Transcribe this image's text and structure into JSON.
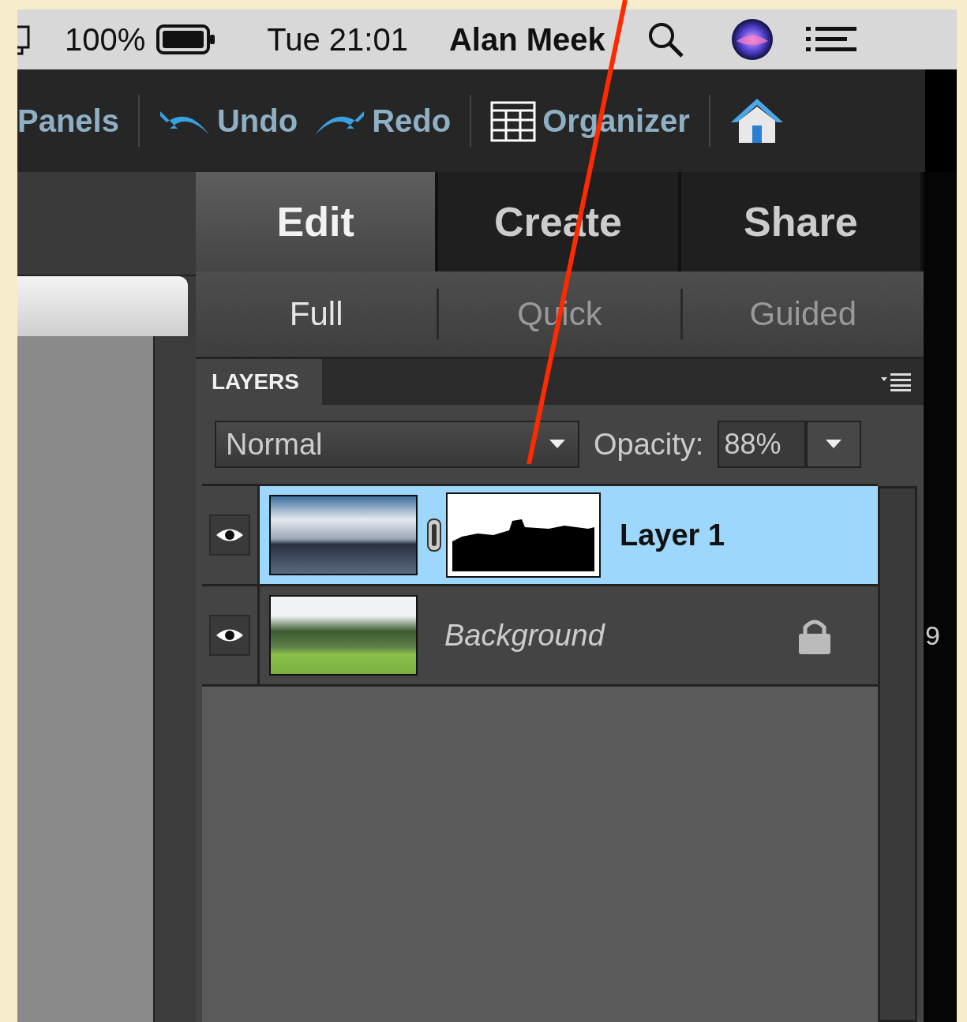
{
  "menubar": {
    "battery_percent": "100%",
    "clock": "Tue 21:01",
    "user": "Alan Meek"
  },
  "toolbar": {
    "items": [
      {
        "kind": "text",
        "label": "Panels"
      },
      {
        "kind": "undo",
        "label": "Undo"
      },
      {
        "kind": "redo",
        "label": "Redo"
      },
      {
        "kind": "organizer",
        "label": "Organizer"
      },
      {
        "kind": "home"
      }
    ]
  },
  "modes": [
    {
      "label": "Edit",
      "selected": true
    },
    {
      "label": "Create",
      "selected": false
    },
    {
      "label": "Share",
      "selected": false
    }
  ],
  "submodes": [
    {
      "label": "Full",
      "selected": true
    },
    {
      "label": "Quick",
      "selected": false
    },
    {
      "label": "Guided",
      "selected": false
    }
  ],
  "layers_panel": {
    "title": "LAYERS",
    "blend_mode": "Normal",
    "opacity_label": "Opacity:",
    "opacity": "88%",
    "layers": [
      {
        "name": "Layer 1",
        "kind": "layer",
        "selected": true,
        "visible": true,
        "has_mask": true,
        "locked": false
      },
      {
        "name": "Background",
        "kind": "background",
        "selected": false,
        "visible": true,
        "has_mask": false,
        "locked": true
      }
    ]
  },
  "edge_text": "9"
}
